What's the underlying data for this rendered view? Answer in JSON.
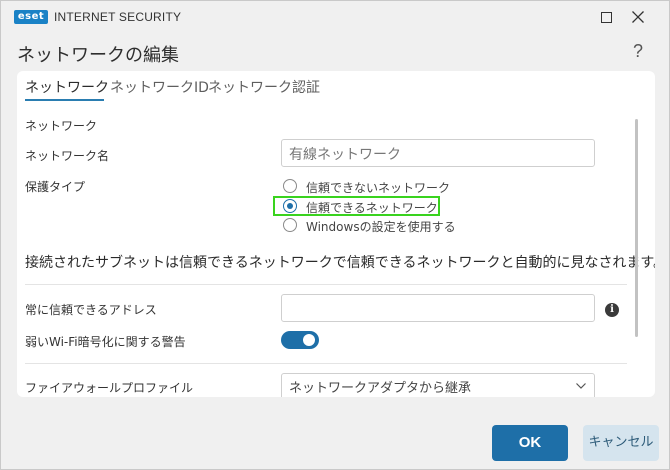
{
  "window": {
    "logo_text": "eset",
    "app_title": "INTERNET SECURITY"
  },
  "dialog": {
    "title": "ネットワークの編集",
    "help": "?"
  },
  "tabs": [
    {
      "label": "ネットワーク",
      "active": true
    },
    {
      "label": "ネットワークID",
      "active": false
    },
    {
      "label": "ネットワーク認証",
      "active": false
    }
  ],
  "network": {
    "section_label": "ネットワーク",
    "name_label": "ネットワーク名",
    "name_value": "有線ネットワーク",
    "protection_label": "保護タイプ",
    "protection_options": [
      {
        "label": "信頼できないネットワーク",
        "checked": false
      },
      {
        "label": "信頼できるネットワーク",
        "checked": true
      },
      {
        "label": "Windowsの設定を使用する",
        "checked": false
      }
    ],
    "info_text": "接続されたサブネットは信頼できるネットワークで信頼できるネットワークと自動的に見なされます。",
    "trusted_address_label": "常に信頼できるアドレス",
    "trusted_address_value": "",
    "wifi_warning_label": "弱いWi-Fi暗号化に関する警告",
    "wifi_warning_enabled": true,
    "firewall_profile_label": "ファイアウォールプロファイル",
    "firewall_profile_value": "ネットワークアダプタから継承"
  },
  "footer": {
    "ok_label": "OK",
    "cancel_label": "キャンセル"
  },
  "colors": {
    "accent": "#1e6fa8",
    "highlight": "#39d31e",
    "cancel_bg": "#d5e4ee"
  }
}
